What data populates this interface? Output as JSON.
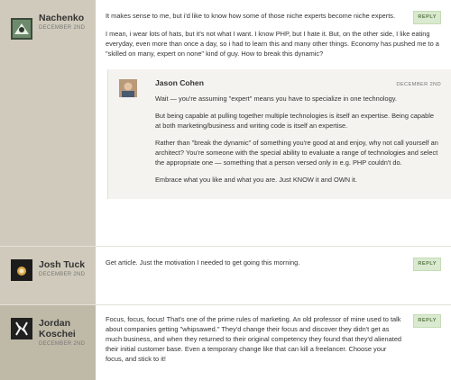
{
  "comments": [
    {
      "author": "Nachenko",
      "date": "DECEMBER 2ND",
      "reply": "REPLY",
      "paragraphs": [
        "It makes sense to me, but i'd like to know how some of those niche experts become niche experts.",
        "I mean, i wear lots of hats, but it's not what I want. I know PHP, but I hate it. But, on the other side, I like eating everyday, even more than once a day, so i had to learn this and many other things. Economy has pushed me to a \"skilled on many, expert on none\" kind of guy. How to break this dynamic?"
      ],
      "reply_comment": {
        "author": "Jason Cohen",
        "date": "DECEMBER 2ND",
        "paragraphs": [
          "Wait — you're assuming \"expert\" means you have to specialize in one technology.",
          "But being capable at pulling together multiple technologies is itself an expertise. Being capable at both marketing/business and writing code is itself an expertise.",
          "Rather than \"break the dynamic\" of something you're good at and enjoy, why not call yourself an architect? You're someone with the special ability to evaluate a range of technologies and select the appropriate one — something that a person versed only in e.g. PHP couldn't do.",
          "Embrace what you like and what you are. Just KNOW it and OWN it."
        ]
      }
    },
    {
      "author": "Josh Tuck",
      "date": "DECEMBER 2ND",
      "reply": "REPLY",
      "paragraphs": [
        "Get article. Just the motivation I needed to get going this morning."
      ]
    },
    {
      "author_line1": "Jordan",
      "author_line2": "Koschei",
      "date": "DECEMBER 2ND",
      "reply": "REPLY",
      "paragraphs": [
        "Focus, focus, focus! That's one of the prime rules of marketing. An old professor of mine used to talk about companies getting \"whipsawed.\" They'd change their focus and discover they didn't get as much business, and when they returned to their original competency they found that they'd alienated their initial customer base. Even a temporary change like that can kill a freelancer. Choose your focus, and stick to it!"
      ]
    }
  ]
}
